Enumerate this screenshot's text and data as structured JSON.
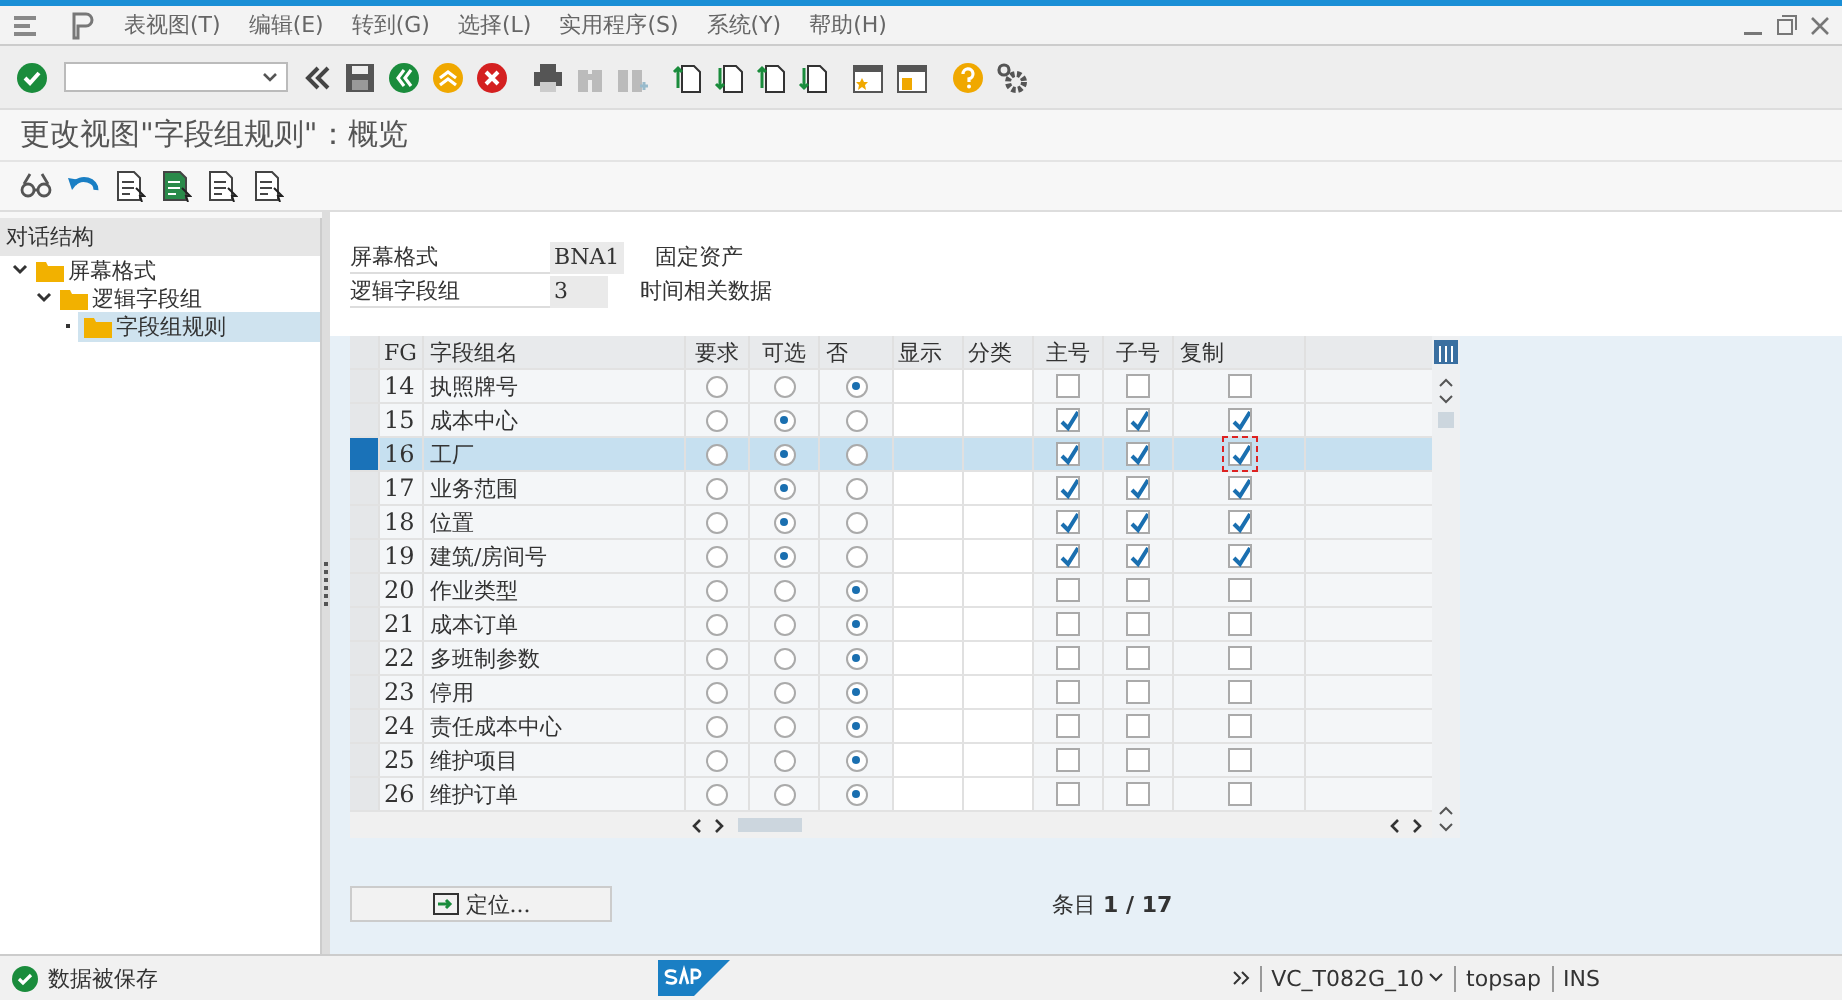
{
  "menu": [
    "表视图(T)",
    "编辑(E)",
    "转到(G)",
    "选择(L)",
    "实用程序(S)",
    "系统(Y)",
    "帮助(H)"
  ],
  "title": "更改视图\"字段组规则\"：概览",
  "tree": {
    "header": "对话结构",
    "items": [
      {
        "label": "屏幕格式",
        "expanded": true,
        "selected": false,
        "children": [
          {
            "label": "逻辑字段组",
            "expanded": true,
            "selected": false,
            "children": [
              {
                "label": "字段组规则",
                "selected": true
              }
            ]
          }
        ]
      }
    ]
  },
  "fields": [
    {
      "label": "屏幕格式",
      "value": "BNA1",
      "description": "固定资产"
    },
    {
      "label": "逻辑字段组",
      "value": "3",
      "description": "时间相关数据"
    }
  ],
  "table": {
    "columns": [
      "FG",
      "字段组名",
      "要求",
      "可选",
      "否",
      "显示",
      "分类",
      "主号",
      "子号",
      "复制"
    ],
    "rows": [
      {
        "fg": "14",
        "name": "执照牌号",
        "selected": false,
        "choice": [
          false,
          false,
          true
        ],
        "checks": [
          false,
          false,
          false
        ]
      },
      {
        "fg": "15",
        "name": "成本中心",
        "selected": false,
        "choice": [
          false,
          true,
          false
        ],
        "checks": [
          true,
          true,
          true
        ]
      },
      {
        "fg": "16",
        "name": "工厂",
        "selected": true,
        "choice": [
          false,
          true,
          false
        ],
        "checks": [
          true,
          true,
          true
        ]
      },
      {
        "fg": "17",
        "name": "业务范围",
        "selected": false,
        "choice": [
          false,
          true,
          false
        ],
        "checks": [
          true,
          true,
          true
        ]
      },
      {
        "fg": "18",
        "name": "位置",
        "selected": false,
        "choice": [
          false,
          true,
          false
        ],
        "checks": [
          true,
          true,
          true
        ]
      },
      {
        "fg": "19",
        "name": "建筑/房间号",
        "selected": false,
        "choice": [
          false,
          true,
          false
        ],
        "checks": [
          true,
          true,
          true
        ]
      },
      {
        "fg": "20",
        "name": "作业类型",
        "selected": false,
        "choice": [
          false,
          false,
          true
        ],
        "checks": [
          false,
          false,
          false
        ]
      },
      {
        "fg": "21",
        "name": "成本订单",
        "selected": false,
        "choice": [
          false,
          false,
          true
        ],
        "checks": [
          false,
          false,
          false
        ]
      },
      {
        "fg": "22",
        "name": "多班制参数",
        "selected": false,
        "choice": [
          false,
          false,
          true
        ],
        "checks": [
          false,
          false,
          false
        ]
      },
      {
        "fg": "23",
        "name": "停用",
        "selected": false,
        "choice": [
          false,
          false,
          true
        ],
        "checks": [
          false,
          false,
          false
        ]
      },
      {
        "fg": "24",
        "name": "责任成本中心",
        "selected": false,
        "choice": [
          false,
          false,
          true
        ],
        "checks": [
          false,
          false,
          false
        ]
      },
      {
        "fg": "25",
        "name": "维护项目",
        "selected": false,
        "choice": [
          false,
          false,
          true
        ],
        "checks": [
          false,
          false,
          false
        ]
      },
      {
        "fg": "26",
        "name": "维护订单",
        "selected": false,
        "choice": [
          false,
          false,
          true
        ],
        "checks": [
          false,
          false,
          false
        ]
      }
    ]
  },
  "position_button": "定位...",
  "entry_label": "条目",
  "entry_count": "1 / 17",
  "status": {
    "message": "数据被保存",
    "transaction": "VC_T082G_10",
    "user": "topsap",
    "mode": "INS"
  }
}
